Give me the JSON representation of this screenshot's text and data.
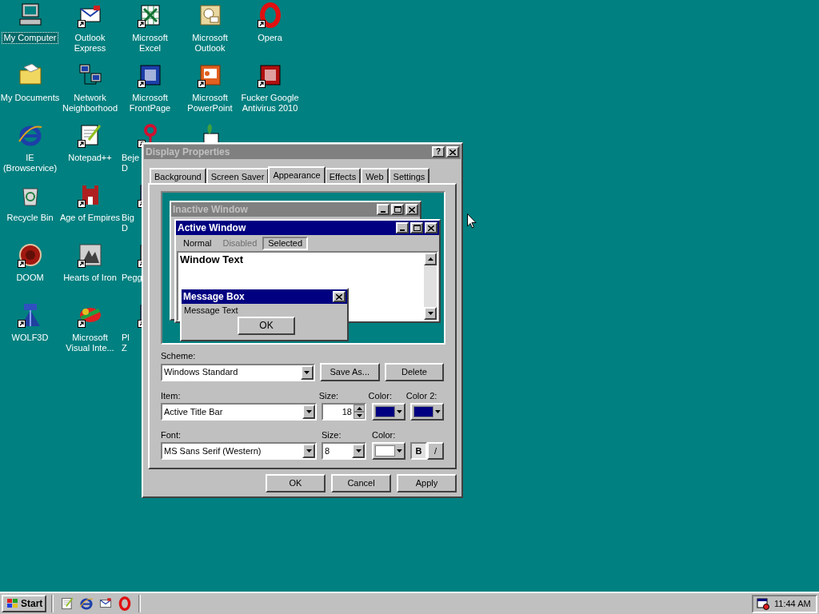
{
  "desktop": {
    "icon_rows": [
      [
        {
          "lines": [
            "My Computer"
          ],
          "shortcut": false,
          "selected": true,
          "cut_off": false
        },
        {
          "lines": [
            "Outlook",
            "Express"
          ],
          "shortcut": true,
          "selected": false,
          "cut_off": false
        },
        {
          "lines": [
            "Microsoft",
            "Excel"
          ],
          "shortcut": true,
          "selected": false,
          "cut_off": false
        },
        {
          "lines": [
            "Microsoft",
            "Outlook"
          ],
          "shortcut": false,
          "selected": false,
          "cut_off": false
        },
        {
          "lines": [
            "Opera"
          ],
          "shortcut": true,
          "selected": false,
          "cut_off": false
        }
      ],
      [
        {
          "lines": [
            "My Documents"
          ],
          "shortcut": false,
          "selected": false,
          "cut_off": false
        },
        {
          "lines": [
            "Network",
            "Neighborhood"
          ],
          "shortcut": false,
          "selected": false,
          "cut_off": false
        },
        {
          "lines": [
            "Microsoft",
            "FrontPage"
          ],
          "shortcut": true,
          "selected": false,
          "cut_off": false
        },
        {
          "lines": [
            "Microsoft",
            "PowerPoint"
          ],
          "shortcut": true,
          "selected": false,
          "cut_off": false
        },
        {
          "lines": [
            "Fucker Google",
            "Antivirus 2010"
          ],
          "shortcut": true,
          "selected": false,
          "cut_off": false
        }
      ],
      [
        {
          "lines": [
            "IE",
            "(Browservice)"
          ],
          "shortcut": false,
          "selected": false,
          "cut_off": false
        },
        {
          "lines": [
            "Notepad++"
          ],
          "shortcut": true,
          "selected": false,
          "cut_off": false
        },
        {
          "lines": [
            "Beje",
            "D"
          ],
          "shortcut": true,
          "selected": false,
          "cut_off": true
        },
        {
          "shortcut": false
        }
      ],
      [
        {
          "lines": [
            "Recycle Bin"
          ],
          "shortcut": false,
          "selected": false,
          "cut_off": false
        },
        {
          "lines": [
            "Age of Empires"
          ],
          "shortcut": true,
          "selected": false,
          "cut_off": false
        },
        {
          "lines": [
            "Big",
            "D"
          ],
          "shortcut": true,
          "selected": false,
          "cut_off": true
        }
      ],
      [
        {
          "lines": [
            "DOOM"
          ],
          "shortcut": true,
          "selected": false,
          "cut_off": false
        },
        {
          "lines": [
            "Hearts of Iron"
          ],
          "shortcut": true,
          "selected": false,
          "cut_off": false
        },
        {
          "lines": [
            "Pegg"
          ],
          "shortcut": true,
          "selected": false,
          "cut_off": true
        }
      ],
      [
        {
          "lines": [
            "WOLF3D"
          ],
          "shortcut": true,
          "selected": false,
          "cut_off": false
        },
        {
          "lines": [
            "Microsoft",
            "Visual Inte..."
          ],
          "shortcut": true,
          "selected": false,
          "cut_off": false
        },
        {
          "lines": [
            "Pl",
            "Z"
          ],
          "shortcut": true,
          "selected": false,
          "cut_off": true
        }
      ]
    ]
  },
  "dialog": {
    "title": "Display Properties",
    "active": false,
    "help": "?",
    "tabs": [
      {
        "label": "Background",
        "selected": false
      },
      {
        "label": "Screen Saver",
        "selected": false
      },
      {
        "label": "Appearance",
        "selected": true
      },
      {
        "label": "Effects",
        "selected": false
      },
      {
        "label": "Web",
        "selected": false
      },
      {
        "label": "Settings",
        "selected": false
      }
    ],
    "preview": {
      "inactive_title": "Inactive Window",
      "active_title": "Active Window",
      "menu": [
        {
          "label": "Normal",
          "disabled": false,
          "selected": false
        },
        {
          "label": "Disabled",
          "disabled": true,
          "selected": false
        },
        {
          "label": "Selected",
          "disabled": false,
          "selected": true
        }
      ],
      "window_text": "Window Text",
      "message_box": {
        "title": "Message Box",
        "text": "Message Text",
        "button": "OK"
      }
    },
    "scheme": {
      "label": "Scheme:",
      "value": "Windows Standard",
      "save_as": "Save As...",
      "delete": "Delete"
    },
    "item": {
      "label": "Item:",
      "value": "Active Title Bar",
      "size_label": "Size:",
      "size": "18",
      "colors": [
        {
          "label": "Color:",
          "color": "#000080"
        },
        {
          "label": "Color 2:",
          "color": "#000080"
        }
      ]
    },
    "font": {
      "label": "Font:",
      "value": "MS Sans Serif (Western)",
      "size_label": "Size:",
      "size": "8",
      "color_label": "Color:",
      "color": "#ffffff",
      "bold": {
        "label": "B",
        "pressed": true
      },
      "italic": {
        "label": "/",
        "pressed": false
      }
    },
    "buttons": [
      "OK",
      "Cancel",
      "Apply"
    ]
  },
  "taskbar": {
    "start": "Start",
    "clock": "11:44 AM"
  }
}
